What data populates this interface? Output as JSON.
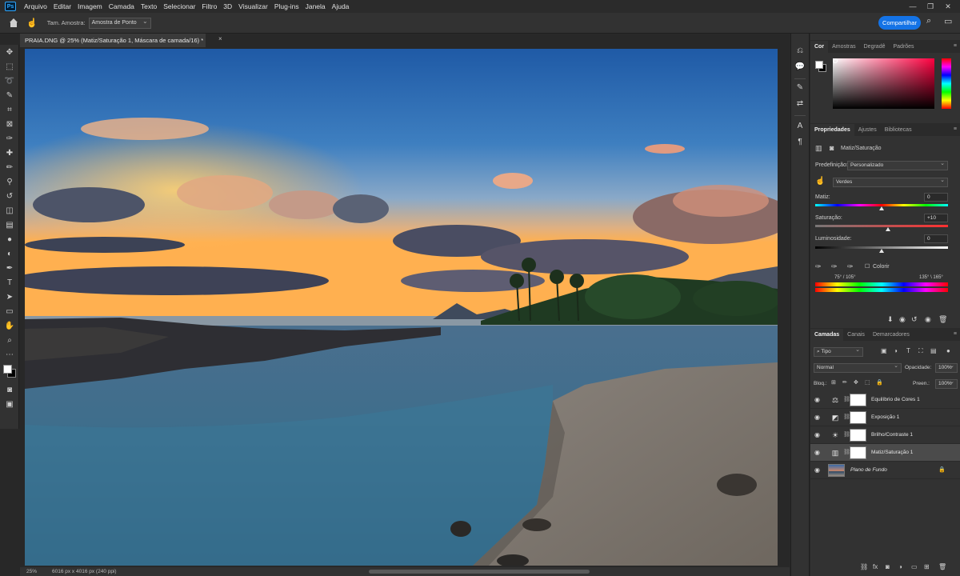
{
  "menubar": {
    "logo": "Ps",
    "items": [
      "Arquivo",
      "Editar",
      "Imagem",
      "Camada",
      "Texto",
      "Selecionar",
      "Filtro",
      "3D",
      "Visualizar",
      "Plug-ins",
      "Janela",
      "Ajuda"
    ],
    "window_controls": [
      "—",
      "❐",
      "✕"
    ]
  },
  "options_bar": {
    "sample_size_label": "Tam. Amostra:",
    "sample_size_value": "Amostra de Ponto",
    "share_label": "Compartilhar",
    "accent_color": "#1473e6"
  },
  "document": {
    "tab_title": "PRAIA.DNG @ 25% (Matiz/Saturação 1, Máscara de camada/16) *",
    "close_glyph": "×",
    "zoom": "25%",
    "info": "6016 px x 4016 px (240 ppi)"
  },
  "color_panel": {
    "tabs": [
      "Cor",
      "Amostras",
      "Degradê",
      "Padrões"
    ],
    "active_tab": "Cor",
    "foreground": "#ffffff",
    "background": "#000000"
  },
  "properties_panel": {
    "tabs": [
      "Propriedades",
      "Ajustes",
      "Bibliotecas"
    ],
    "active_tab": "Propriedades",
    "title": "Matiz/Saturação",
    "preset_label": "Predefinição:",
    "preset_value": "Personalizado",
    "channel_value": "Verdes",
    "hue_label": "Matiz:",
    "hue_value": "0",
    "hue_position": 0.5,
    "saturation_label": "Saturação:",
    "saturation_value": "+10",
    "saturation_position": 0.55,
    "lightness_label": "Luminosidade:",
    "lightness_value": "0",
    "lightness_position": 0.5,
    "colorize_label": "Colorir",
    "range_left": "75° / 105°",
    "range_right": "135° \\ 165°"
  },
  "layers_panel": {
    "tabs": [
      "Camadas",
      "Canais",
      "Demarcadores"
    ],
    "active_tab": "Camadas",
    "filter_value": "Tipo",
    "blend_mode": "Normal",
    "opacity_label": "Opacidade:",
    "opacity_value": "100%",
    "lock_label": "Bloq.:",
    "fill_label": "Preen.:",
    "fill_value": "100%",
    "layers": [
      {
        "name": "Equilíbrio de Cores 1",
        "icon": "color-balance-icon",
        "glyph": "⚖"
      },
      {
        "name": "Exposição 1",
        "icon": "exposure-icon",
        "glyph": "◩"
      },
      {
        "name": "Brilho/Contraste 1",
        "icon": "brightness-contrast-icon",
        "glyph": "☀"
      },
      {
        "name": "Matiz/Saturação 1",
        "icon": "hue-saturation-icon",
        "glyph": "▥"
      }
    ],
    "background_layer": "Plano de Fundo"
  }
}
